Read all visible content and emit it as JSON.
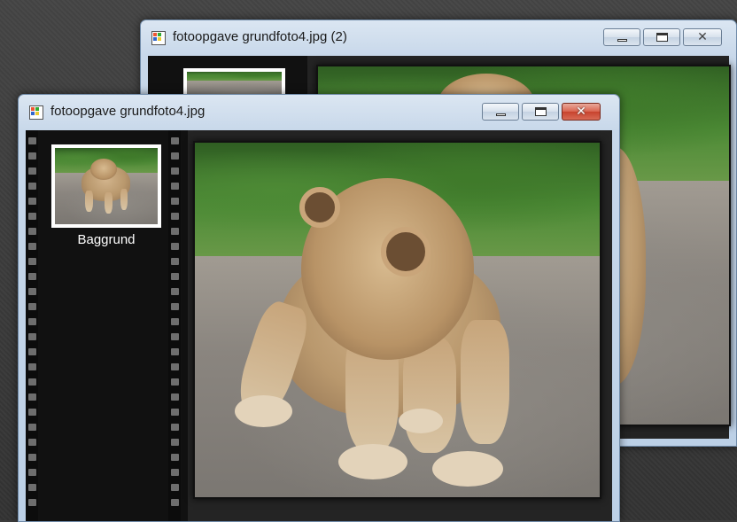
{
  "windows": [
    {
      "id": "back",
      "title": "fotoopgave grundfoto4.jpg (2)",
      "active": false,
      "buttons": {
        "minimize": "minimize",
        "maximize": "maximize",
        "close": "✕"
      }
    },
    {
      "id": "front",
      "title": "fotoopgave grundfoto4.jpg",
      "active": true,
      "buttons": {
        "minimize": "minimize",
        "maximize": "maximize",
        "close": "✕"
      },
      "layers": [
        {
          "label": "Baggrund"
        }
      ]
    }
  ],
  "icons": [
    "app-icon",
    "minimize-icon",
    "maximize-icon",
    "close-icon"
  ],
  "colors": {
    "title_bar": "#c8d8ea",
    "close_button": "#c7432d",
    "filmstrip": "#111111",
    "desktop": "#3c3c3c"
  }
}
